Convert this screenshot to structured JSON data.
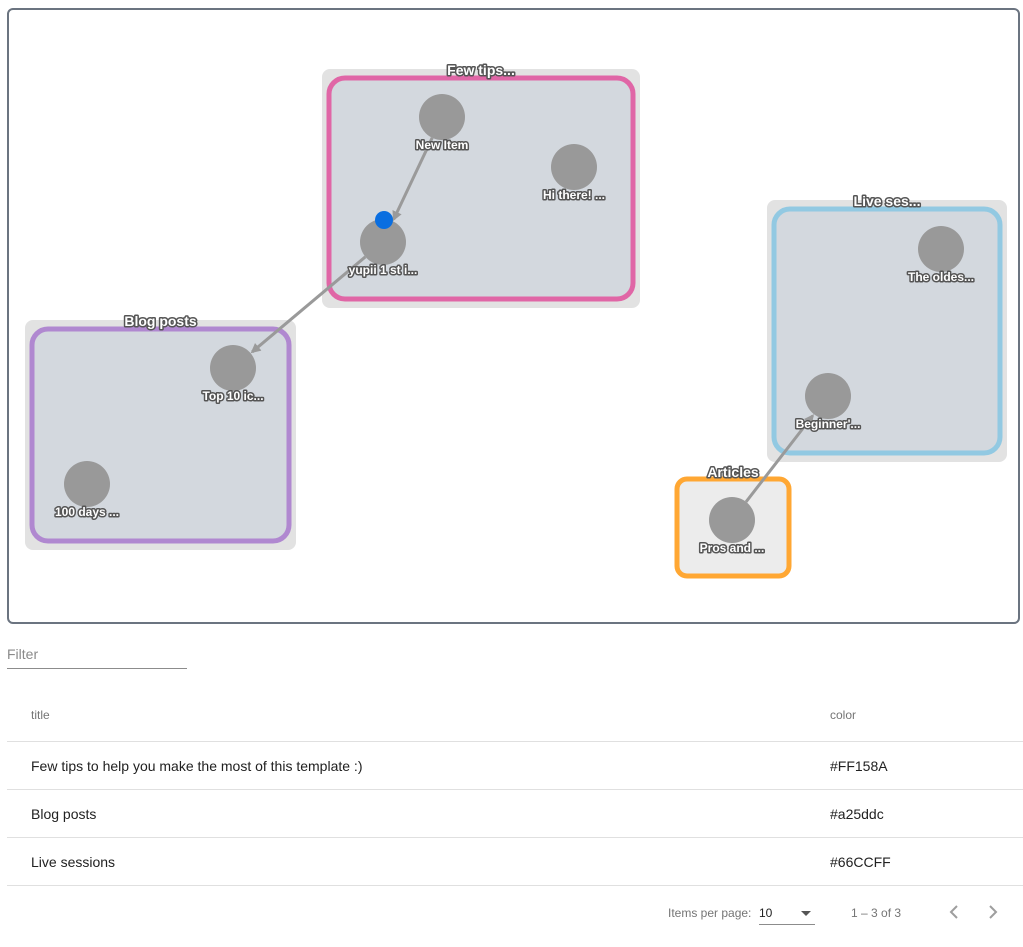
{
  "graph": {
    "groups": [
      {
        "id": "tips",
        "label": "Few tips...",
        "color": "#e066a6"
      },
      {
        "id": "blog",
        "label": "Blog posts",
        "color": "#b088d0"
      },
      {
        "id": "live",
        "label": "Live ses...",
        "color": "#92c9e2"
      },
      {
        "id": "articles",
        "label": "Articles",
        "color": "#ffa733"
      }
    ],
    "nodes": [
      {
        "id": "new",
        "label": "New Item",
        "group": "tips"
      },
      {
        "id": "hi",
        "label": "Hi there! ...",
        "group": "tips"
      },
      {
        "id": "yupii",
        "label": "yupii 1 st i...",
        "group": "tips"
      },
      {
        "id": "top10",
        "label": "Top 10 ic...",
        "group": "blog"
      },
      {
        "id": "days100",
        "label": "100 days ...",
        "group": "blog"
      },
      {
        "id": "oldest",
        "label": "The oldes...",
        "group": "live"
      },
      {
        "id": "beginner",
        "label": "Beginner'...",
        "group": "live"
      },
      {
        "id": "pros",
        "label": "Pros and ...",
        "group": "articles"
      }
    ],
    "edges": [
      {
        "from": "new",
        "to": "yupii"
      },
      {
        "from": "yupii",
        "to": "top10"
      },
      {
        "from": "pros",
        "to": "beginner"
      }
    ],
    "node_color": "#999999",
    "edge_color": "#9a9a9a",
    "selected_dot_color": "#0a6ee0"
  },
  "filter": {
    "placeholder": "Filter",
    "value": ""
  },
  "table": {
    "headers": {
      "title": "title",
      "color": "color"
    },
    "rows": [
      {
        "title": "Few tips to help you make the most of this template :)",
        "color": "#FF158A"
      },
      {
        "title": "Blog posts",
        "color": "#a25ddc"
      },
      {
        "title": "Live sessions",
        "color": "#66CCFF"
      }
    ]
  },
  "paginator": {
    "items_per_page_label": "Items per page:",
    "page_size": "10",
    "range_label": "1 – 3 of 3"
  }
}
